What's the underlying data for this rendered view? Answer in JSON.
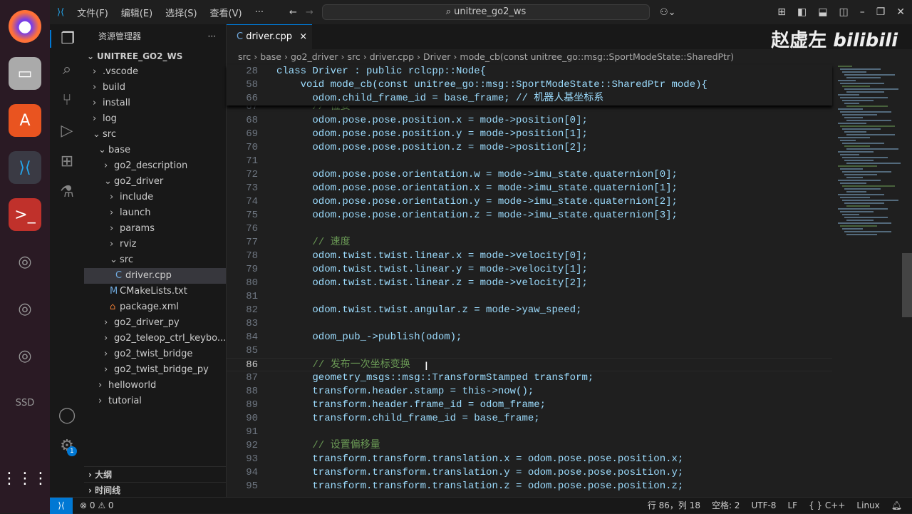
{
  "title_bar": {
    "menus": [
      "文件(F)",
      "编辑(E)",
      "选择(S)",
      "查看(V)",
      "···"
    ],
    "search": "unitree_go2_ws"
  },
  "watermark": {
    "author": "赵虚左",
    "logo": "bilibili"
  },
  "sidebar": {
    "title": "资源管理器",
    "more": "···",
    "root": "UNITREE_GO2_WS",
    "items": [
      {
        "label": ".vscode",
        "depth": 1,
        "chev": ">"
      },
      {
        "label": "build",
        "depth": 1,
        "chev": ">"
      },
      {
        "label": "install",
        "depth": 1,
        "chev": ">"
      },
      {
        "label": "log",
        "depth": 1,
        "chev": ">"
      },
      {
        "label": "src",
        "depth": 1,
        "chev": "v"
      },
      {
        "label": "base",
        "depth": 2,
        "chev": "v"
      },
      {
        "label": "go2_description",
        "depth": 3,
        "chev": ">"
      },
      {
        "label": "go2_driver",
        "depth": 3,
        "chev": "v"
      },
      {
        "label": "include",
        "depth": 4,
        "chev": ">"
      },
      {
        "label": "launch",
        "depth": 4,
        "chev": ">"
      },
      {
        "label": "params",
        "depth": 4,
        "chev": ">"
      },
      {
        "label": "rviz",
        "depth": 4,
        "chev": ">"
      },
      {
        "label": "src",
        "depth": 4,
        "chev": "v"
      },
      {
        "label": "driver.cpp",
        "depth": 5,
        "chev": "C",
        "selected": true
      },
      {
        "label": "CMakeLists.txt",
        "depth": 4,
        "chev": "M"
      },
      {
        "label": "package.xml",
        "depth": 4,
        "chev": "⌂"
      },
      {
        "label": "go2_driver_py",
        "depth": 3,
        "chev": ">"
      },
      {
        "label": "go2_teleop_ctrl_keybo...",
        "depth": 3,
        "chev": ">"
      },
      {
        "label": "go2_twist_bridge",
        "depth": 3,
        "chev": ">"
      },
      {
        "label": "go2_twist_bridge_py",
        "depth": 3,
        "chev": ">"
      },
      {
        "label": "helloworld",
        "depth": 2,
        "chev": ">"
      },
      {
        "label": "tutorial",
        "depth": 2,
        "chev": ">"
      }
    ],
    "outline": "大纲",
    "timeline": "时间线"
  },
  "tab": {
    "label": "driver.cpp",
    "close": "×"
  },
  "breadcrumb": [
    "src",
    "base",
    "go2_driver",
    "src",
    "driver.cpp",
    "Driver",
    "mode_cb(const unitree_go::msg::SportModeState::SharedPtr)"
  ],
  "sticky": [
    {
      "n": "28",
      "text": "class Driver : public rclcpp::Node{"
    },
    {
      "n": "58",
      "text": "    void mode_cb(const unitree_go::msg::SportModeState::SharedPtr mode){"
    },
    {
      "n": "66",
      "text": "      odom.child_frame_id = base_frame; // 机器人基坐标系"
    }
  ],
  "code": [
    {
      "n": "67",
      "text": "      // 位姿"
    },
    {
      "n": "68",
      "text": "      odom.pose.pose.position.x = mode->position[0];"
    },
    {
      "n": "69",
      "text": "      odom.pose.pose.position.y = mode->position[1];"
    },
    {
      "n": "70",
      "text": "      odom.pose.pose.position.z = mode->position[2];"
    },
    {
      "n": "71",
      "text": ""
    },
    {
      "n": "72",
      "text": "      odom.pose.pose.orientation.w = mode->imu_state.quaternion[0];"
    },
    {
      "n": "73",
      "text": "      odom.pose.pose.orientation.x = mode->imu_state.quaternion[1];"
    },
    {
      "n": "74",
      "text": "      odom.pose.pose.orientation.y = mode->imu_state.quaternion[2];"
    },
    {
      "n": "75",
      "text": "      odom.pose.pose.orientation.z = mode->imu_state.quaternion[3];"
    },
    {
      "n": "76",
      "text": ""
    },
    {
      "n": "77",
      "text": "      // 速度"
    },
    {
      "n": "78",
      "text": "      odom.twist.twist.linear.x = mode->velocity[0];"
    },
    {
      "n": "79",
      "text": "      odom.twist.twist.linear.y = mode->velocity[1];"
    },
    {
      "n": "80",
      "text": "      odom.twist.twist.linear.z = mode->velocity[2];"
    },
    {
      "n": "81",
      "text": ""
    },
    {
      "n": "82",
      "text": "      odom.twist.twist.angular.z = mode->yaw_speed;"
    },
    {
      "n": "83",
      "text": ""
    },
    {
      "n": "84",
      "text": "      odom_pub_->publish(odom);"
    },
    {
      "n": "85",
      "text": ""
    },
    {
      "n": "86",
      "text": "      // 发布一次坐标变换",
      "current": true
    },
    {
      "n": "87",
      "text": "      geometry_msgs::msg::TransformStamped transform;"
    },
    {
      "n": "88",
      "text": "      transform.header.stamp = this->now();"
    },
    {
      "n": "89",
      "text": "      transform.header.frame_id = odom_frame;"
    },
    {
      "n": "90",
      "text": "      transform.child_frame_id = base_frame;"
    },
    {
      "n": "91",
      "text": ""
    },
    {
      "n": "92",
      "text": "      // 设置偏移量"
    },
    {
      "n": "93",
      "text": "      transform.transform.translation.x = odom.pose.pose.position.x;"
    },
    {
      "n": "94",
      "text": "      transform.transform.translation.y = odom.pose.pose.position.y;"
    },
    {
      "n": "95",
      "text": "      transform.transform.translation.z = odom.pose.pose.position.z;"
    }
  ],
  "status": {
    "errors": "0",
    "warnings": "0",
    "position": "行 86，列 18",
    "spaces": "空格: 2",
    "encoding": "UTF-8",
    "eol": "LF",
    "language": "{ } C++",
    "os": "Linux",
    "badge": "1"
  },
  "colors": {
    "accent": "#0078d4",
    "background": "#1f1f1f"
  }
}
